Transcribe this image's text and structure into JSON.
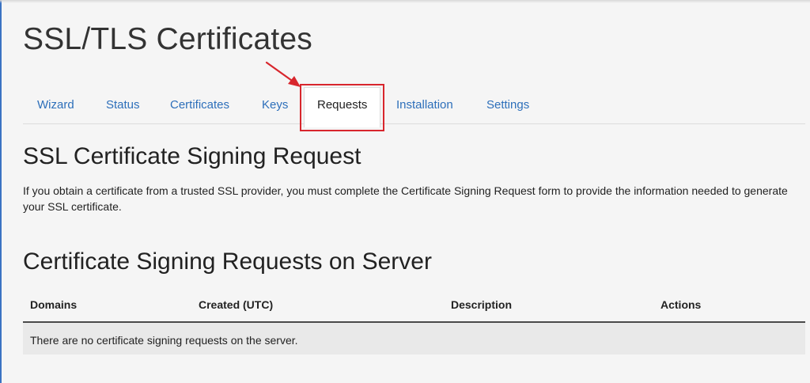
{
  "page": {
    "title": "SSL/TLS Certificates"
  },
  "tabs": [
    {
      "label": "Wizard",
      "active": false
    },
    {
      "label": "Status",
      "active": false
    },
    {
      "label": "Certificates",
      "active": false
    },
    {
      "label": "Keys",
      "active": false
    },
    {
      "label": "Requests",
      "active": true
    },
    {
      "label": "Installation",
      "active": false
    },
    {
      "label": "Settings",
      "active": false
    }
  ],
  "csr_section": {
    "title": "SSL Certificate Signing Request",
    "description": "If you obtain a certificate from a trusted SSL provider, you must complete the Certificate Signing Request form to provide the information needed to generate your SSL certificate."
  },
  "server_section": {
    "title": "Certificate Signing Requests on Server",
    "columns": [
      "Domains",
      "Created (UTC)",
      "Description",
      "Actions"
    ],
    "empty_message": "There are no certificate signing requests on the server."
  },
  "colors": {
    "accent": "#2d6fba",
    "annotation": "#d8262d"
  },
  "icons": {
    "annotation": "red-arrow-icon"
  }
}
